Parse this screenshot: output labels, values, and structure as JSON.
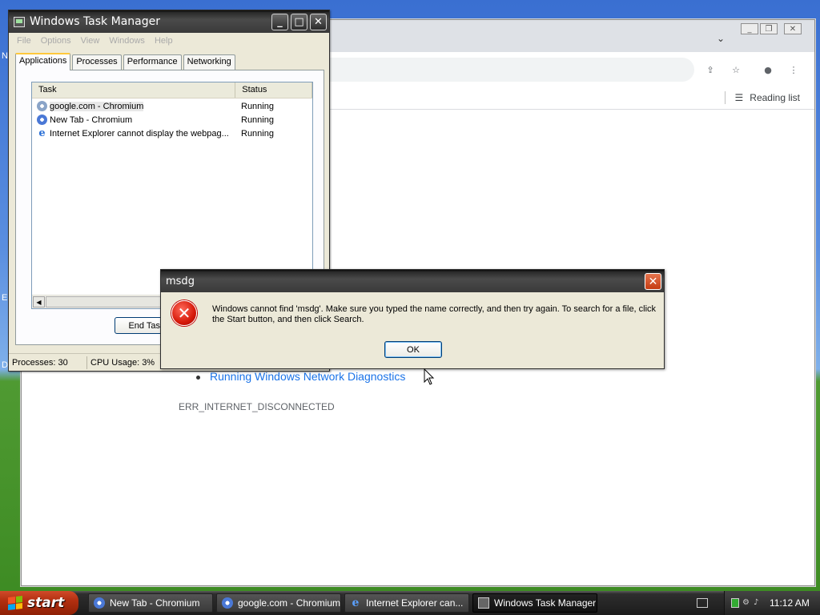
{
  "taskmgr": {
    "title": "Windows Task Manager",
    "menu": [
      "File",
      "Options",
      "View",
      "Windows",
      "Help"
    ],
    "tabs": [
      "Applications",
      "Processes",
      "Performance",
      "Networking"
    ],
    "columns": [
      "Task",
      "Status"
    ],
    "rows": [
      {
        "task": "google.com - Chromium",
        "status": "Running",
        "icon": "chromium-icon"
      },
      {
        "task": "New Tab - Chromium",
        "status": "Running",
        "icon": "chromium-icon"
      },
      {
        "task": "Internet Explorer cannot display the webpag...",
        "status": "Running",
        "icon": "ie-icon"
      }
    ],
    "end_task": "End Task",
    "status": {
      "processes": "Processes: 30",
      "cpu": "CPU Usage: 3%"
    }
  },
  "browser": {
    "reading_list": "Reading list",
    "link": "Running Windows Network Diagnostics",
    "error_code": "ERR_INTERNET_DISCONNECTED"
  },
  "dialog": {
    "title": "msdg",
    "message": "Windows cannot find 'msdg'. Make sure you typed the name correctly, and then try again. To search for a file, click the Start button, and then click Search.",
    "ok": "OK"
  },
  "taskbar": {
    "start": "start",
    "items": [
      {
        "label": "New Tab - Chromium",
        "icon": "chromium-icon"
      },
      {
        "label": "google.com - Chromium",
        "icon": "chromium-icon"
      },
      {
        "label": "Internet Explorer can...",
        "icon": "ie-icon"
      },
      {
        "label": "Windows Task Manager",
        "icon": "task-manager-icon"
      }
    ],
    "clock": "11:12 AM"
  }
}
